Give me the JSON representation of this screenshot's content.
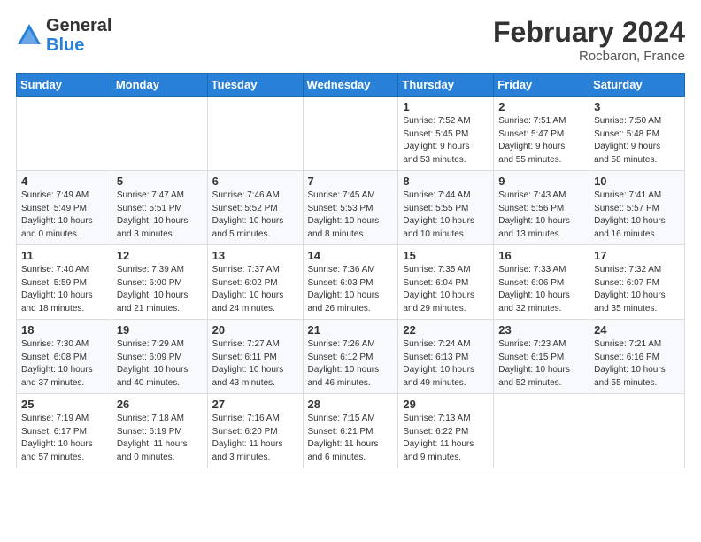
{
  "header": {
    "logo_general": "General",
    "logo_blue": "Blue",
    "month_title": "February 2024",
    "location": "Rocbaron, France"
  },
  "weekdays": [
    "Sunday",
    "Monday",
    "Tuesday",
    "Wednesday",
    "Thursday",
    "Friday",
    "Saturday"
  ],
  "weeks": [
    [
      {
        "day": "",
        "info": ""
      },
      {
        "day": "",
        "info": ""
      },
      {
        "day": "",
        "info": ""
      },
      {
        "day": "",
        "info": ""
      },
      {
        "day": "1",
        "info": "Sunrise: 7:52 AM\nSunset: 5:45 PM\nDaylight: 9 hours\nand 53 minutes."
      },
      {
        "day": "2",
        "info": "Sunrise: 7:51 AM\nSunset: 5:47 PM\nDaylight: 9 hours\nand 55 minutes."
      },
      {
        "day": "3",
        "info": "Sunrise: 7:50 AM\nSunset: 5:48 PM\nDaylight: 9 hours\nand 58 minutes."
      }
    ],
    [
      {
        "day": "4",
        "info": "Sunrise: 7:49 AM\nSunset: 5:49 PM\nDaylight: 10 hours\nand 0 minutes."
      },
      {
        "day": "5",
        "info": "Sunrise: 7:47 AM\nSunset: 5:51 PM\nDaylight: 10 hours\nand 3 minutes."
      },
      {
        "day": "6",
        "info": "Sunrise: 7:46 AM\nSunset: 5:52 PM\nDaylight: 10 hours\nand 5 minutes."
      },
      {
        "day": "7",
        "info": "Sunrise: 7:45 AM\nSunset: 5:53 PM\nDaylight: 10 hours\nand 8 minutes."
      },
      {
        "day": "8",
        "info": "Sunrise: 7:44 AM\nSunset: 5:55 PM\nDaylight: 10 hours\nand 10 minutes."
      },
      {
        "day": "9",
        "info": "Sunrise: 7:43 AM\nSunset: 5:56 PM\nDaylight: 10 hours\nand 13 minutes."
      },
      {
        "day": "10",
        "info": "Sunrise: 7:41 AM\nSunset: 5:57 PM\nDaylight: 10 hours\nand 16 minutes."
      }
    ],
    [
      {
        "day": "11",
        "info": "Sunrise: 7:40 AM\nSunset: 5:59 PM\nDaylight: 10 hours\nand 18 minutes."
      },
      {
        "day": "12",
        "info": "Sunrise: 7:39 AM\nSunset: 6:00 PM\nDaylight: 10 hours\nand 21 minutes."
      },
      {
        "day": "13",
        "info": "Sunrise: 7:37 AM\nSunset: 6:02 PM\nDaylight: 10 hours\nand 24 minutes."
      },
      {
        "day": "14",
        "info": "Sunrise: 7:36 AM\nSunset: 6:03 PM\nDaylight: 10 hours\nand 26 minutes."
      },
      {
        "day": "15",
        "info": "Sunrise: 7:35 AM\nSunset: 6:04 PM\nDaylight: 10 hours\nand 29 minutes."
      },
      {
        "day": "16",
        "info": "Sunrise: 7:33 AM\nSunset: 6:06 PM\nDaylight: 10 hours\nand 32 minutes."
      },
      {
        "day": "17",
        "info": "Sunrise: 7:32 AM\nSunset: 6:07 PM\nDaylight: 10 hours\nand 35 minutes."
      }
    ],
    [
      {
        "day": "18",
        "info": "Sunrise: 7:30 AM\nSunset: 6:08 PM\nDaylight: 10 hours\nand 37 minutes."
      },
      {
        "day": "19",
        "info": "Sunrise: 7:29 AM\nSunset: 6:09 PM\nDaylight: 10 hours\nand 40 minutes."
      },
      {
        "day": "20",
        "info": "Sunrise: 7:27 AM\nSunset: 6:11 PM\nDaylight: 10 hours\nand 43 minutes."
      },
      {
        "day": "21",
        "info": "Sunrise: 7:26 AM\nSunset: 6:12 PM\nDaylight: 10 hours\nand 46 minutes."
      },
      {
        "day": "22",
        "info": "Sunrise: 7:24 AM\nSunset: 6:13 PM\nDaylight: 10 hours\nand 49 minutes."
      },
      {
        "day": "23",
        "info": "Sunrise: 7:23 AM\nSunset: 6:15 PM\nDaylight: 10 hours\nand 52 minutes."
      },
      {
        "day": "24",
        "info": "Sunrise: 7:21 AM\nSunset: 6:16 PM\nDaylight: 10 hours\nand 55 minutes."
      }
    ],
    [
      {
        "day": "25",
        "info": "Sunrise: 7:19 AM\nSunset: 6:17 PM\nDaylight: 10 hours\nand 57 minutes."
      },
      {
        "day": "26",
        "info": "Sunrise: 7:18 AM\nSunset: 6:19 PM\nDaylight: 11 hours\nand 0 minutes."
      },
      {
        "day": "27",
        "info": "Sunrise: 7:16 AM\nSunset: 6:20 PM\nDaylight: 11 hours\nand 3 minutes."
      },
      {
        "day": "28",
        "info": "Sunrise: 7:15 AM\nSunset: 6:21 PM\nDaylight: 11 hours\nand 6 minutes."
      },
      {
        "day": "29",
        "info": "Sunrise: 7:13 AM\nSunset: 6:22 PM\nDaylight: 11 hours\nand 9 minutes."
      },
      {
        "day": "",
        "info": ""
      },
      {
        "day": "",
        "info": ""
      }
    ]
  ]
}
